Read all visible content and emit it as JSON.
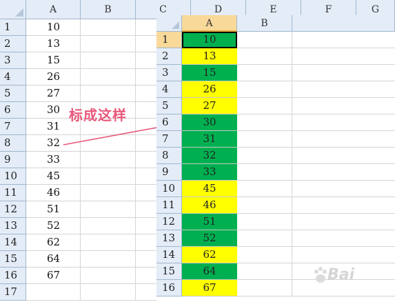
{
  "background_sheet": {
    "columns": [
      "A",
      "B",
      "C",
      "D",
      "E",
      "F",
      "G"
    ],
    "rows": [
      "1",
      "2",
      "3",
      "4",
      "5",
      "6",
      "7",
      "8",
      "9",
      "10",
      "11",
      "12",
      "13",
      "14",
      "15",
      "16",
      "17"
    ],
    "values": [
      "10",
      "13",
      "15",
      "26",
      "27",
      "30",
      "31",
      "32",
      "33",
      "45",
      "46",
      "51",
      "52",
      "62",
      "64",
      "67",
      ""
    ]
  },
  "annotation": {
    "text": "标成这样",
    "color": "#e8587a"
  },
  "overlay_sheet": {
    "columns": [
      "A",
      "B"
    ],
    "selected_column": "A",
    "rows": [
      "1",
      "2",
      "3",
      "4",
      "5",
      "6",
      "7",
      "8",
      "9",
      "10",
      "11",
      "12",
      "13",
      "14",
      "15",
      "16"
    ],
    "cells": [
      {
        "value": "10",
        "fill": "green"
      },
      {
        "value": "13",
        "fill": "yellow"
      },
      {
        "value": "15",
        "fill": "green"
      },
      {
        "value": "26",
        "fill": "yellow"
      },
      {
        "value": "27",
        "fill": "yellow"
      },
      {
        "value": "30",
        "fill": "green"
      },
      {
        "value": "31",
        "fill": "green"
      },
      {
        "value": "32",
        "fill": "green"
      },
      {
        "value": "33",
        "fill": "green"
      },
      {
        "value": "45",
        "fill": "yellow"
      },
      {
        "value": "46",
        "fill": "yellow"
      },
      {
        "value": "51",
        "fill": "green"
      },
      {
        "value": "52",
        "fill": "green"
      },
      {
        "value": "62",
        "fill": "yellow"
      },
      {
        "value": "64",
        "fill": "green"
      },
      {
        "value": "67",
        "fill": "yellow"
      }
    ],
    "colors": {
      "green": "#00b050",
      "yellow": "#ffff00"
    }
  },
  "watermark": {
    "text": "Bai"
  }
}
